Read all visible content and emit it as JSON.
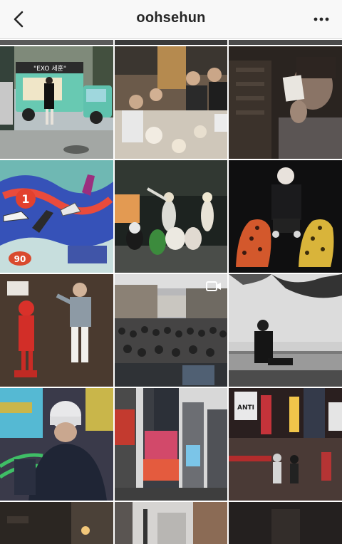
{
  "header": {
    "username": "oohsehun",
    "back_icon": "chevron-left-icon",
    "more_icon": "more-horizontal-icon"
  },
  "grid": {
    "posts": [
      {
        "id": "post-food-truck",
        "badges": []
      },
      {
        "id": "post-restaurant-group",
        "badges": []
      },
      {
        "id": "post-theater-selfie",
        "badges": []
      },
      {
        "id": "post-graffiti-sneakers",
        "badges": []
      },
      {
        "id": "post-stage-mascots",
        "badges": []
      },
      {
        "id": "post-leopard-statues",
        "badges": []
      },
      {
        "id": "post-red-statue",
        "badges": []
      },
      {
        "id": "post-street-crowd",
        "badges": [
          "video-camera-icon"
        ]
      },
      {
        "id": "post-seaside-bw",
        "badges": []
      },
      {
        "id": "post-beanie-portrait",
        "badges": []
      },
      {
        "id": "post-times-square-day",
        "badges": []
      },
      {
        "id": "post-times-square-night",
        "badges": []
      }
    ],
    "sign_texts": {
      "truck_banner": "\"EXO 세훈\"",
      "graffiti_number": "90",
      "billboard_anti": "ANTI"
    }
  }
}
